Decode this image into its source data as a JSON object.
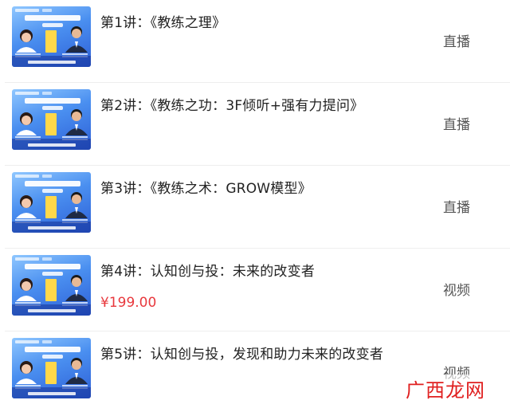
{
  "lessons": [
    {
      "title": "第1讲：《教练之理》",
      "price": "",
      "type": "直播"
    },
    {
      "title": "第2讲：《教练之功：3F倾听+强有力提问》",
      "price": "",
      "type": "直播"
    },
    {
      "title": "第3讲：《教练之术：GROW模型》",
      "price": "",
      "type": "直播"
    },
    {
      "title": "第4讲：认知创与投：未来的改变者",
      "price": "¥199.00",
      "type": "视频"
    },
    {
      "title": "第5讲：认知创与投，发现和助力未来的改变者",
      "price": "",
      "type": "视频"
    }
  ],
  "watermark": "广西龙网",
  "colors": {
    "price": "#e8383d",
    "title": "#222222",
    "type": "#555555",
    "thumbnail_bg": "#4a8ff0"
  }
}
